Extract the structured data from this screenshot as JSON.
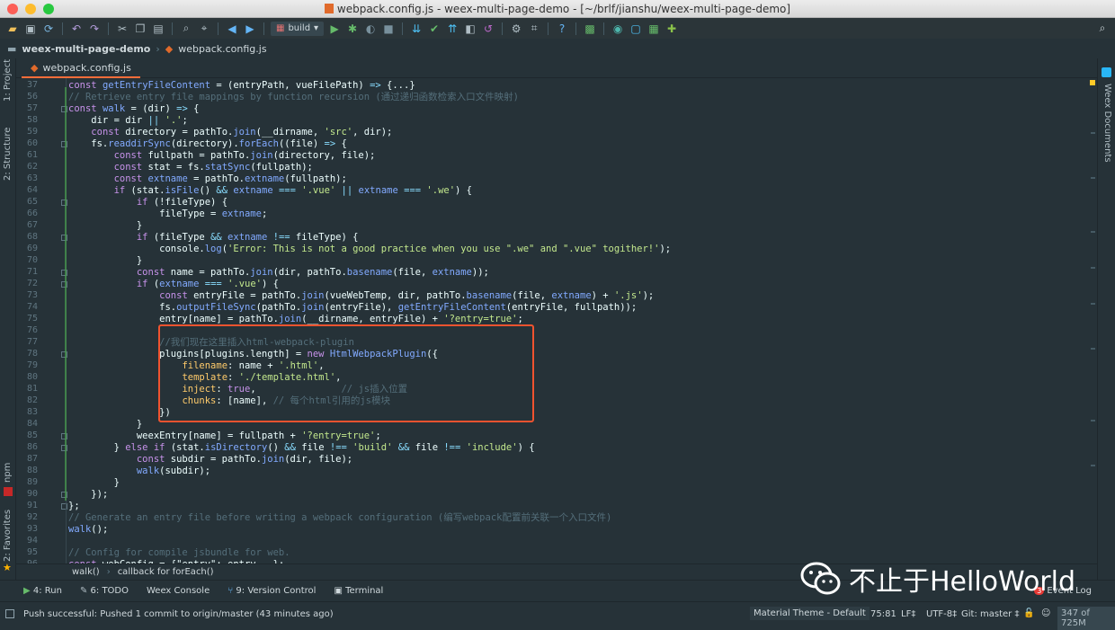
{
  "window": {
    "title": "webpack.config.js - weex-multi-page-demo - [~/brlf/jianshu/weex-multi-page-demo]"
  },
  "toolbar": {
    "run_config": "build"
  },
  "nav": {
    "project": "weex-multi-page-demo",
    "file": "webpack.config.js"
  },
  "tab": {
    "label": "webpack.config.js"
  },
  "left_tools": {
    "project": "1: Project",
    "structure": "2: Structure",
    "npm": "npm",
    "favorites": "2: Favorites"
  },
  "right_tools": {
    "weex_docs": "Weex Documents"
  },
  "editor": {
    "lines": [
      {
        "n": "37",
        "t": "const getEntryFileContent = (entryPath, vueFilePath) => {...}"
      },
      {
        "n": "56",
        "t": "// Retrieve entry file mappings by function recursion (通过递归函数检索入口文件映射)"
      },
      {
        "n": "57",
        "t": "const walk = (dir) => {"
      },
      {
        "n": "58",
        "t": "    dir = dir || '.';"
      },
      {
        "n": "59",
        "t": "    const directory = pathTo.join(__dirname, 'src', dir);"
      },
      {
        "n": "60",
        "t": "    fs.readdirSync(directory).forEach((file) => {"
      },
      {
        "n": "61",
        "t": "        const fullpath = pathTo.join(directory, file);"
      },
      {
        "n": "62",
        "t": "        const stat = fs.statSync(fullpath);"
      },
      {
        "n": "63",
        "t": "        const extname = pathTo.extname(fullpath);"
      },
      {
        "n": "64",
        "t": "        if (stat.isFile() && extname === '.vue' || extname === '.we') {"
      },
      {
        "n": "65",
        "t": "            if (!fileType) {"
      },
      {
        "n": "66",
        "t": "                fileType = extname;"
      },
      {
        "n": "67",
        "t": "            }"
      },
      {
        "n": "68",
        "t": "            if (fileType && extname !== fileType) {"
      },
      {
        "n": "69",
        "t": "                console.log('Error: This is not a good practice when you use \".we\" and \".vue\" togither!');"
      },
      {
        "n": "70",
        "t": "            }"
      },
      {
        "n": "71",
        "t": "            const name = pathTo.join(dir, pathTo.basename(file, extname));"
      },
      {
        "n": "72",
        "t": "            if (extname === '.vue') {"
      },
      {
        "n": "73",
        "t": "                const entryFile = pathTo.join(vueWebTemp, dir, pathTo.basename(file, extname) + '.js');"
      },
      {
        "n": "74",
        "t": "                fs.outputFileSync(pathTo.join(entryFile), getEntryFileContent(entryFile, fullpath));"
      },
      {
        "n": "75",
        "t": "                entry[name] = pathTo.join(__dirname, entryFile) + '?entry=true';"
      },
      {
        "n": "76",
        "t": ""
      },
      {
        "n": "77",
        "t": "                //我们现在这里插入html-webpack-plugin"
      },
      {
        "n": "78",
        "t": "                plugins[plugins.length] = new HtmlWebpackPlugin({"
      },
      {
        "n": "79",
        "t": "                    filename: name + '.html',"
      },
      {
        "n": "80",
        "t": "                    template: './template.html',"
      },
      {
        "n": "81",
        "t": "                    inject: true,               // js插入位置"
      },
      {
        "n": "82",
        "t": "                    chunks: [name], // 每个html引用的js模块"
      },
      {
        "n": "83",
        "t": "                })"
      },
      {
        "n": "84",
        "t": "            }"
      },
      {
        "n": "85",
        "t": "            weexEntry[name] = fullpath + '?entry=true';"
      },
      {
        "n": "86",
        "t": "        } else if (stat.isDirectory() && file !== 'build' && file !== 'include') {"
      },
      {
        "n": "87",
        "t": "            const subdir = pathTo.join(dir, file);"
      },
      {
        "n": "88",
        "t": "            walk(subdir);"
      },
      {
        "n": "89",
        "t": "        }"
      },
      {
        "n": "90",
        "t": "    });"
      },
      {
        "n": "91",
        "t": "};"
      },
      {
        "n": "92",
        "t": "// Generate an entry file before writing a webpack configuration (编写webpack配置前关联一个入口文件)"
      },
      {
        "n": "93",
        "t": "walk();"
      },
      {
        "n": "94",
        "t": ""
      },
      {
        "n": "95",
        "t": "// Config for compile jsbundle for web."
      },
      {
        "n": "96",
        "t": "const webConfig = {\"entry\": entry,  };"
      }
    ]
  },
  "breadcrumb": {
    "item1": "walk()",
    "item2": "callback for forEach()"
  },
  "tool_windows": {
    "run": "4: Run",
    "todo": "6: TODO",
    "weex_console": "Weex Console",
    "vcs": "9: Version Control",
    "terminal": "Terminal",
    "event_log": "Event Log",
    "event_count": "3"
  },
  "status": {
    "message": "Push successful: Pushed 1 commit to origin/master (43 minutes ago)",
    "theme": "Material Theme - Default",
    "position": "75:81",
    "line_sep": "LF‡",
    "encoding": "UTF-8‡",
    "git": "Git: master ‡",
    "memory": "347 of 725M"
  },
  "watermark": {
    "text": "不止于HelloWorld"
  },
  "colors": {
    "accent": "#ff6d3a",
    "highlight_box": "#f0532f",
    "bg": "#263238"
  }
}
